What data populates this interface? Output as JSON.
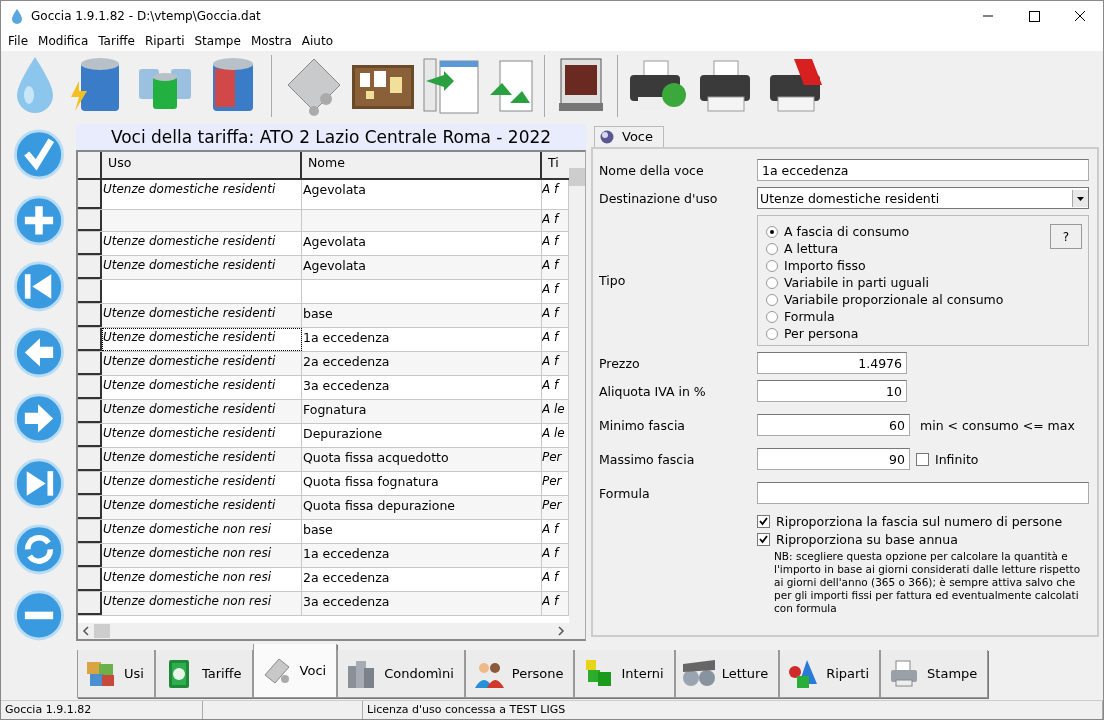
{
  "window": {
    "title": "Goccia 1.9.1.82 - D:\\vtemp\\Goccia.dat"
  },
  "menu": [
    {
      "label": "File"
    },
    {
      "label": "Modifica"
    },
    {
      "label": "Tariffe"
    },
    {
      "label": "Riparti"
    },
    {
      "label": "Stampe"
    },
    {
      "label": "Mostra"
    },
    {
      "label": "Aiuto"
    }
  ],
  "table": {
    "title": "Voci della tariffa: ATO 2 Lazio Centrale Roma - 2022",
    "columns": [
      "Uso",
      "Nome",
      "Ti"
    ],
    "rows": [
      {
        "uso": "Utenze domestiche residenti",
        "nome": "Agevolata",
        "tipo": "A f",
        "focused": false
      },
      {
        "tipo": "A f",
        "focused": false
      },
      {
        "uso": "Utenze domestiche residenti",
        "nome": "Agevolata",
        "tipo": "A f",
        "focused": false
      },
      {
        "uso": "Utenze domestiche residenti",
        "nome": "Agevolata",
        "tipo": "A f",
        "focused": false
      },
      {
        "tipo": "A f",
        "focused": false
      },
      {
        "uso": "Utenze domestiche residenti",
        "nome": "base",
        "tipo": "A f",
        "focused": false
      },
      {
        "uso": "Utenze domestiche residenti",
        "nome": "1a eccedenza",
        "tipo": "A f",
        "focused": true
      },
      {
        "uso": "Utenze domestiche residenti",
        "nome": "2a eccedenza",
        "tipo": "A f",
        "focused": false
      },
      {
        "uso": "Utenze domestiche residenti",
        "nome": "3a eccedenza",
        "tipo": "A f",
        "focused": false
      },
      {
        "uso": "Utenze domestiche residenti",
        "nome": "Fognatura",
        "tipo": "A le",
        "focused": false
      },
      {
        "uso": "Utenze domestiche residenti",
        "nome": "Depurazione",
        "tipo": "A le",
        "focused": false
      },
      {
        "uso": "Utenze domestiche residenti",
        "nome": "Quota fissa acquedotto",
        "tipo": "Per",
        "focused": false
      },
      {
        "uso": "Utenze domestiche residenti",
        "nome": "Quota fissa fognatura",
        "tipo": "Per",
        "focused": false
      },
      {
        "uso": "Utenze domestiche residenti",
        "nome": "Quota fissa depurazione",
        "tipo": "Per",
        "focused": false
      },
      {
        "uso": "Utenze domestiche non resi",
        "nome": "base",
        "tipo": "A f",
        "focused": false
      },
      {
        "uso": "Utenze domestiche non resi",
        "nome": "1a eccedenza",
        "tipo": "A f",
        "focused": false
      },
      {
        "uso": "Utenze domestiche non resi",
        "nome": "2a eccedenza",
        "tipo": "A f",
        "focused": false
      },
      {
        "uso": "Utenze domestiche non resi",
        "nome": "3a eccedenza",
        "tipo": "A f",
        "focused": false
      }
    ]
  },
  "form": {
    "tab": "Voce",
    "nome_label": "Nome della voce",
    "nome_value": "1a eccedenza",
    "destinazione_label": "Destinazione d'uso",
    "destinazione_value": "Utenze domestiche residenti",
    "tipo_label": "Tipo",
    "help_button": "?",
    "tipo_options": [
      {
        "label": "A fascia di consumo",
        "selected": true
      },
      {
        "label": "A lettura",
        "selected": false
      },
      {
        "label": "Importo fisso",
        "selected": false
      },
      {
        "label": "Variabile in parti uguali",
        "selected": false
      },
      {
        "label": "Variabile proporzionale al consumo",
        "selected": false
      },
      {
        "label": "Formula",
        "selected": false
      },
      {
        "label": "Per persona",
        "selected": false
      }
    ],
    "prezzo_label": "Prezzo",
    "prezzo_value": "1.4976",
    "iva_label": "Aliquota IVA in %",
    "iva_value": "10",
    "minimo_label": "Minimo fascia",
    "minimo_value": "60",
    "minimo_hint": "min < consumo <= max",
    "massimo_label": "Massimo fascia",
    "massimo_value": "90",
    "infinito": {
      "label": "Infinito",
      "checked": false
    },
    "formula_label": "Formula",
    "options": [
      {
        "label": "Riproporziona la fascia sul numero di persone",
        "checked": true
      },
      {
        "label": "Riproporziona su base annua",
        "checked": true
      }
    ],
    "note": "NB: scegliere questa opzione per calcolare la quantità e l'importo in base ai giorni considerati dalle letture rispetto ai giorni dell'anno (365 o 366);  è sempre attiva salvo che per gli importi fissi per fattura ed eventualmente calcolati con formula"
  },
  "bottom_tabs": [
    {
      "label": "Usi",
      "selected": false
    },
    {
      "label": "Tariffe",
      "selected": false
    },
    {
      "label": "Voci",
      "selected": true
    },
    {
      "label": "Condomìni",
      "selected": false
    },
    {
      "label": "Persone",
      "selected": false
    },
    {
      "label": "Interni",
      "selected": false
    },
    {
      "label": "Letture",
      "selected": false
    },
    {
      "label": "Riparti",
      "selected": false
    },
    {
      "label": "Stampe",
      "selected": false
    }
  ],
  "status_bar": {
    "version": "Goccia 1.9.1.82",
    "license": "Licenza d'uso concessa a TEST LIGS"
  }
}
